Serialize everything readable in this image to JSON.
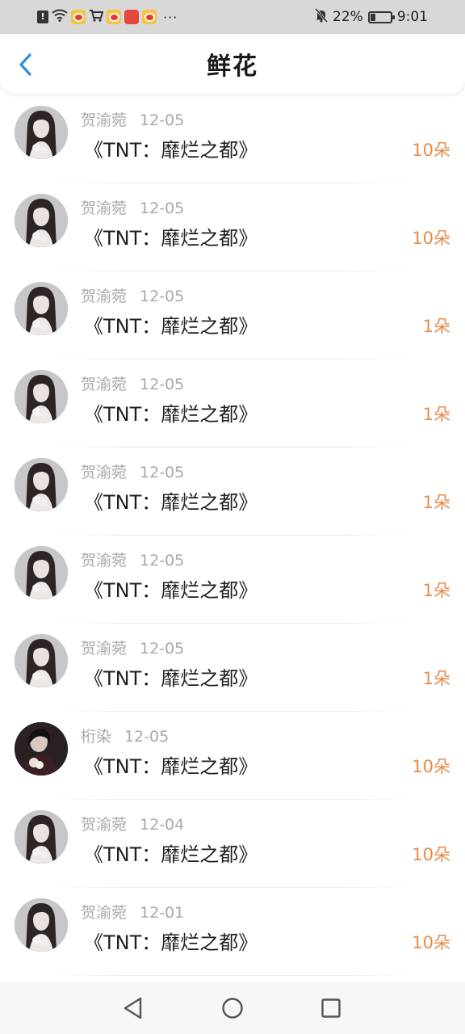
{
  "status_bar": {
    "battery_pct": "22%",
    "battery_level": 0.22,
    "time": "9:01",
    "more": "···",
    "icons": [
      "notification-icon",
      "wifi-icon",
      "weibo-app-icon",
      "cart-icon",
      "weibo-app-icon",
      "red-app-icon",
      "weibo-app-icon",
      "mute-bell-icon",
      "battery-icon"
    ]
  },
  "header": {
    "title": "鲜花",
    "back_icon": "chevron-left-icon",
    "accent": "#2c8fe0"
  },
  "colors": {
    "count": "#e88b4a",
    "meta": "#a8a8a8"
  },
  "items": [
    {
      "user": "贺渝菀",
      "date": "12-05",
      "book": "《TNT：靡烂之都》",
      "count": "10朵",
      "avatar": "a"
    },
    {
      "user": "贺渝菀",
      "date": "12-05",
      "book": "《TNT：靡烂之都》",
      "count": "10朵",
      "avatar": "a"
    },
    {
      "user": "贺渝菀",
      "date": "12-05",
      "book": "《TNT：靡烂之都》",
      "count": "1朵",
      "avatar": "a"
    },
    {
      "user": "贺渝菀",
      "date": "12-05",
      "book": "《TNT：靡烂之都》",
      "count": "1朵",
      "avatar": "a"
    },
    {
      "user": "贺渝菀",
      "date": "12-05",
      "book": "《TNT：靡烂之都》",
      "count": "1朵",
      "avatar": "a"
    },
    {
      "user": "贺渝菀",
      "date": "12-05",
      "book": "《TNT：靡烂之都》",
      "count": "1朵",
      "avatar": "a"
    },
    {
      "user": "贺渝菀",
      "date": "12-05",
      "book": "《TNT：靡烂之都》",
      "count": "1朵",
      "avatar": "a"
    },
    {
      "user": "桁染",
      "date": "12-05",
      "book": "《TNT：靡烂之都》",
      "count": "10朵",
      "avatar": "b"
    },
    {
      "user": "贺渝菀",
      "date": "12-04",
      "book": "《TNT：靡烂之都》",
      "count": "10朵",
      "avatar": "a"
    },
    {
      "user": "贺渝菀",
      "date": "12-01",
      "book": "《TNT：靡烂之都》",
      "count": "10朵",
      "avatar": "a"
    }
  ],
  "nav": {
    "back_icon": "triangle-back-icon",
    "home_icon": "circle-home-icon",
    "recent_icon": "square-recents-icon"
  }
}
